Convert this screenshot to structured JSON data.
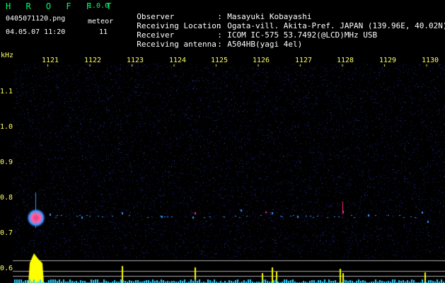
{
  "app": {
    "title": "H R O F F T",
    "version": "1.0.0",
    "filename": "0405071120.png",
    "meteor_label": "meteor",
    "datetime": "04.05.07 11:20",
    "meteor_count": "11"
  },
  "metadata": [
    {
      "key": "Observer",
      "value": "Masayuki Kobayashi"
    },
    {
      "key": "Receiving Location",
      "value": "Ogata-vill. Akita-Pref. JAPAN (139.96E, 40.02N)"
    },
    {
      "key": "Receiver",
      "value": "ICOM IC-575 53.7492(@LCD)MHz USB"
    },
    {
      "key": "Receiving antenna",
      "value": "A504HB(yagi 4el)"
    }
  ],
  "plot": {
    "y_unit": "kHz",
    "x_ticks": [
      "1121",
      "1122",
      "1123",
      "1124",
      "1125",
      "1126",
      "1127",
      "1128",
      "1129",
      "1130"
    ],
    "y_ticks": [
      "1.1",
      "1.0",
      "0.9",
      "0.8",
      "0.7",
      "0.6"
    ],
    "colors": {
      "background": "#000000",
      "noise": "#1a1a66",
      "axis_text": "#ffff66",
      "header_green": "#00ff66",
      "meteor_hot": "#ff3366",
      "meteor_cold": "#3399ff",
      "histogram": "#ffff00",
      "histogram_low": "#33ccff",
      "guide_line": "#aaaaaa"
    }
  }
}
